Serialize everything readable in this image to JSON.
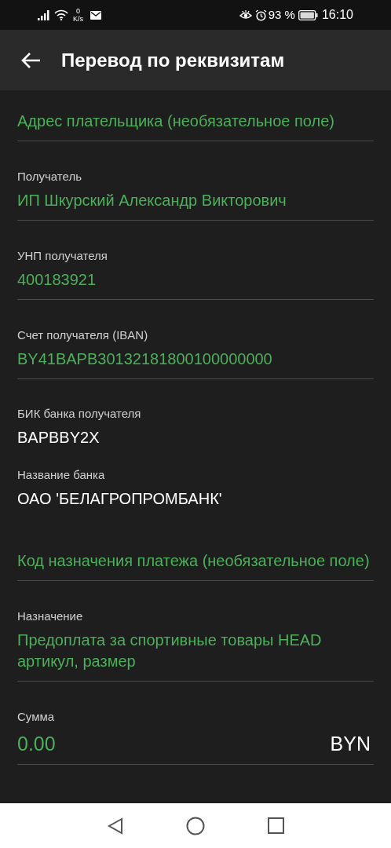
{
  "status_bar": {
    "net_speed_value": "0",
    "net_speed_unit": "K/s",
    "battery": "93 %",
    "time": "16:10"
  },
  "app_bar": {
    "title": "Перевод по реквизитам"
  },
  "fields": [
    {
      "kind": "placeholder",
      "text": "Адрес плательщика (необязательное поле)"
    },
    {
      "kind": "input",
      "label": "Получатель",
      "value": "ИП Шкурский Александр Викторович"
    },
    {
      "kind": "input",
      "label": "УНП получателя",
      "value": "400183921"
    },
    {
      "kind": "input",
      "label": "Счет получателя (IBAN)",
      "value": "BY41BAPB30132181800100000000"
    },
    {
      "kind": "static",
      "label": "БИК банка получателя",
      "value": "BAPBBY2X"
    },
    {
      "kind": "static",
      "label": "Название банка",
      "value": "ОАО 'БЕЛАГРОПРОМБАНК'"
    },
    {
      "kind": "placeholder",
      "text": "Код назначения платежа (необязательное поле)"
    },
    {
      "kind": "input",
      "label": "Назначение",
      "value": "Предоплата за спортивные товары HEAD артикул, размер"
    },
    {
      "kind": "amount",
      "label": "Сумма",
      "value": "0.00",
      "currency": "BYN"
    }
  ]
}
